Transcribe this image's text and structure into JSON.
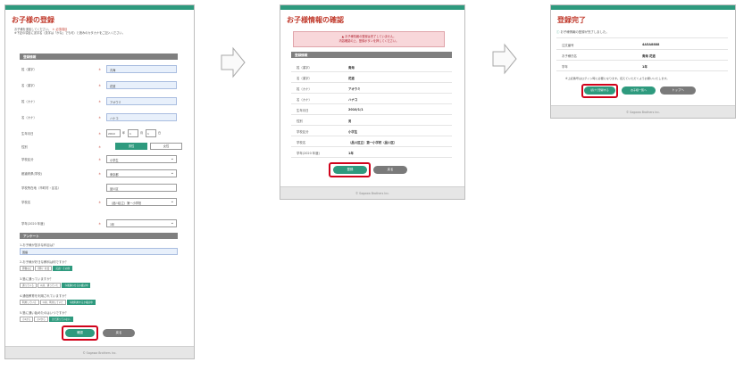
{
  "screen1": {
    "title": "お子様の登録",
    "intro_line1": "お子様を追加してください。",
    "intro_required": "＊ 必須項目",
    "intro_line2": "※下記の項目に漢字名（漢字は「かな」でも可）と読みのカタカナをご記入ください。",
    "section_basic": "登録情報",
    "fields": [
      {
        "label": "姓（漢字）",
        "required": "＊",
        "value": "青海"
      },
      {
        "label": "名（漢字）",
        "required": "＊",
        "value": "花道"
      },
      {
        "label": "姓（カナ）",
        "required": "＊",
        "value": "アオウミ"
      },
      {
        "label": "名（カナ）",
        "required": "＊",
        "value": "ハナコ"
      }
    ],
    "birthdate_label": "生年月日",
    "birthdate_required": "＊",
    "birth_year": "2010",
    "birth_month": "1",
    "birth_day": "1",
    "birth_year_unit": "年",
    "birth_month_unit": "月",
    "birth_day_unit": "日",
    "gender_label": "性別",
    "gender_required": "＊",
    "gender_male": "男性",
    "gender_female": "女性",
    "school_type_label": "学校区分",
    "school_type_required": "＊",
    "school_type_value": "小学生",
    "prefecture_label": "都道府県(学校)",
    "prefecture_required": "＊",
    "prefecture_value": "東京都",
    "city_label": "学校所在地（市町村・区名）",
    "city_value": "品川区",
    "school_label": "学校名",
    "school_required": "＊",
    "school_value": "（品川区立）第一小学校",
    "grade_label": "学年(2020 年度)",
    "grade_required": "＊",
    "grade_value": "1年",
    "section_survey": "アンケート",
    "q1": "1.お子様が苦手な科目は？",
    "q1_value": "国語",
    "q2": "2.お子様が好きな教科は何ですか？",
    "q2_options": [
      "算数など",
      "理科・社会",
      "英語・その他"
    ],
    "q3": "3.塾に通っていますか？",
    "q3_options": [
      "通っている",
      "以前、通っていた",
      "今後通わせるか検討中"
    ],
    "q4": "4.通信教育を利用されていますか？",
    "q4_options": [
      "利用している",
      "以前、利用していた",
      "今後利用するか検討中"
    ],
    "q5": "5.塾に通い始めたのはいつですか？",
    "q5_options": [
      "小1から",
      "小2から",
      "まだ通っていない"
    ],
    "confirm_button": "確認",
    "back_button": "戻る",
    "footer": "© Sagawa Brothers Inc."
  },
  "screen2": {
    "title": "お子様情報の確認",
    "alert_line1": "お子様情報の登録は完了していません。",
    "alert_line2": "内容確認の上、登録ボタンを押してください。",
    "section": "登録情報",
    "rows": [
      {
        "label": "姓（漢字）",
        "value": "青海"
      },
      {
        "label": "名（漢字）",
        "value": "花道"
      },
      {
        "label": "姓（カナ）",
        "value": "アオウミ"
      },
      {
        "label": "名（カナ）",
        "value": "ハナコ"
      },
      {
        "label": "生年月日",
        "value": "2010/1/1"
      },
      {
        "label": "性別",
        "value": "男"
      },
      {
        "label": "学校区分",
        "value": "小学生"
      },
      {
        "label": "学校名",
        "value": "（品川区立）第一小学校（品川区）"
      },
      {
        "label": "学年(2020 年度)",
        "value": "1年"
      }
    ],
    "register_button": "登録",
    "back_button": "戻る",
    "footer": "© Sagawa Brothers Inc."
  },
  "screen3": {
    "title": "登録完了",
    "done_message": "お子様情報の登録が完了しました。",
    "rows": [
      {
        "label": "注文番号",
        "value": "4A5A8888"
      },
      {
        "label": "お子様氏名",
        "value": "青海 花道"
      },
      {
        "label": "学年",
        "value": "1年"
      }
    ],
    "note": "※上記番号はログイン時に必要になります。控えていただくようお願いいたします。",
    "btn_continue": "続けて登録する",
    "btn_list": "お子様一覧へ",
    "btn_top": "トップへ",
    "footer": "© Sagawa Brothers Inc."
  }
}
